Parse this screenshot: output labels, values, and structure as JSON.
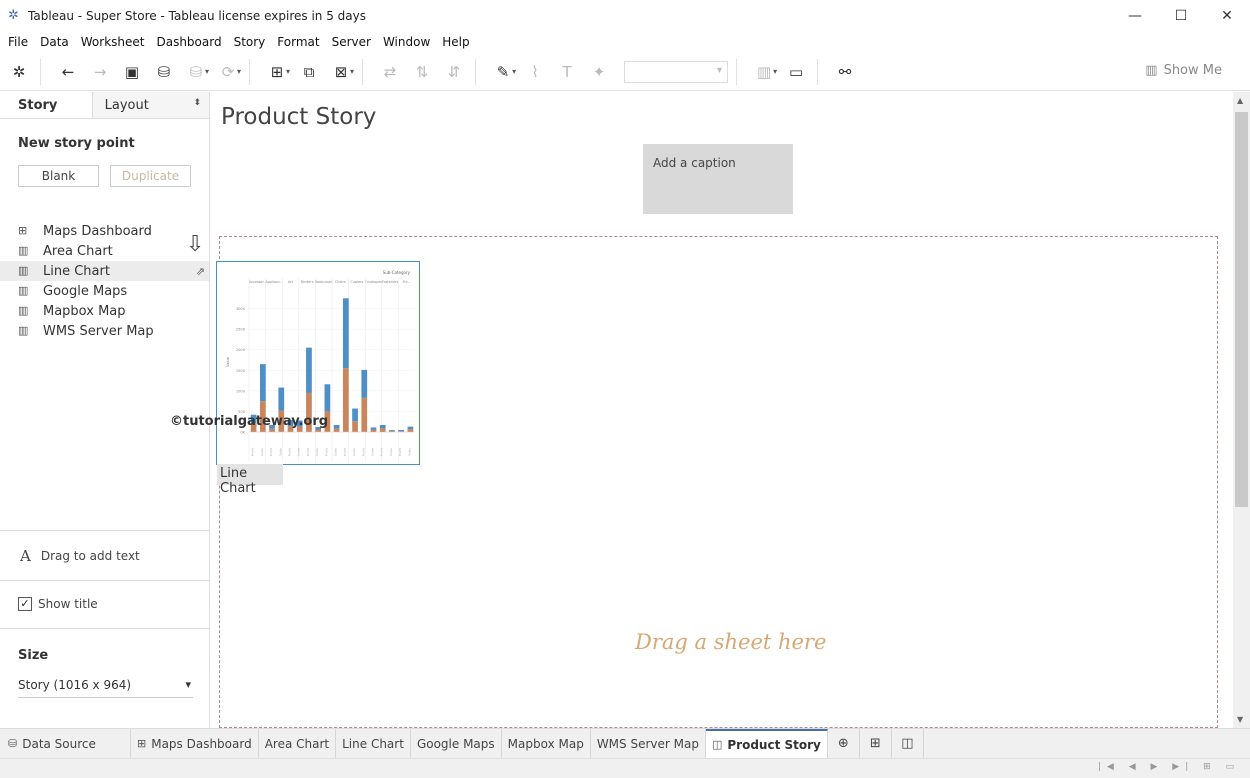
{
  "window": {
    "title": "Tableau - Super Store - Tableau license expires in 5 days",
    "controls": [
      "—",
      "☐",
      "✕"
    ]
  },
  "menu": [
    "File",
    "Data",
    "Worksheet",
    "Dashboard",
    "Story",
    "Format",
    "Server",
    "Window",
    "Help"
  ],
  "toolbar": {
    "show_me": "Show Me"
  },
  "left_panel": {
    "tabs": {
      "story": "Story",
      "layout": "Layout"
    },
    "new_story_point": "New story point",
    "blank_button": "Blank",
    "duplicate_button": "Duplicate",
    "sheets": [
      {
        "label": "Maps Dashboard",
        "icon": "dashboard-icon"
      },
      {
        "label": "Area Chart",
        "icon": "worksheet-icon"
      },
      {
        "label": "Line Chart",
        "icon": "worksheet-icon",
        "active": true
      },
      {
        "label": "Google Maps",
        "icon": "worksheet-icon"
      },
      {
        "label": "Mapbox Map",
        "icon": "worksheet-icon"
      },
      {
        "label": "WMS Server Map",
        "icon": "worksheet-icon"
      }
    ],
    "drag_to_add_text": "Drag to add text",
    "show_title": "Show title",
    "size_label": "Size",
    "size_value": "Story (1016 x 964)"
  },
  "watermark": "©tutorialgateway.org",
  "canvas": {
    "story_title": "Product Story",
    "caption": "Add a caption",
    "drop_hint": "Drag a sheet here",
    "thumbnail_label": "Line Chart"
  },
  "bottom_tabs": {
    "data_source": "Data Source",
    "sheets": [
      "Maps Dashboard",
      "Area Chart",
      "Line Chart",
      "Google Maps",
      "Mapbox Map",
      "WMS Server Map",
      "Product Story"
    ],
    "active": "Product Story"
  },
  "colors": {
    "accent": "#4a6fa5",
    "orange_series": "#c9865c",
    "blue_series": "#4e8fc7",
    "drop_hint": "#d8a874"
  },
  "chart_data": {
    "type": "bar",
    "title": "",
    "header": "Sub-Category",
    "ylabel": "Value",
    "ylim": [
      0,
      3500
    ],
    "yticks": [
      "0K",
      "500",
      "1000",
      "1500",
      "2000",
      "2500",
      "3000"
    ],
    "categories": [
      "Accessories",
      "Appliances",
      "Art",
      "Binders",
      "Bookcases",
      "Chairs",
      "Copiers",
      "Envelopes",
      "Fasteners",
      "Fur..."
    ],
    "series": [
      {
        "values": [
          200,
          750,
          80,
          520,
          140,
          130,
          950,
          60,
          500,
          80,
          1550,
          260,
          830,
          60,
          90,
          30,
          20,
          70
        ]
      },
      {
        "values": [
          220,
          900,
          90,
          560,
          150,
          150,
          1100,
          60,
          660,
          90,
          1700,
          310,
          680,
          50,
          80,
          20,
          30,
          60
        ]
      }
    ]
  }
}
